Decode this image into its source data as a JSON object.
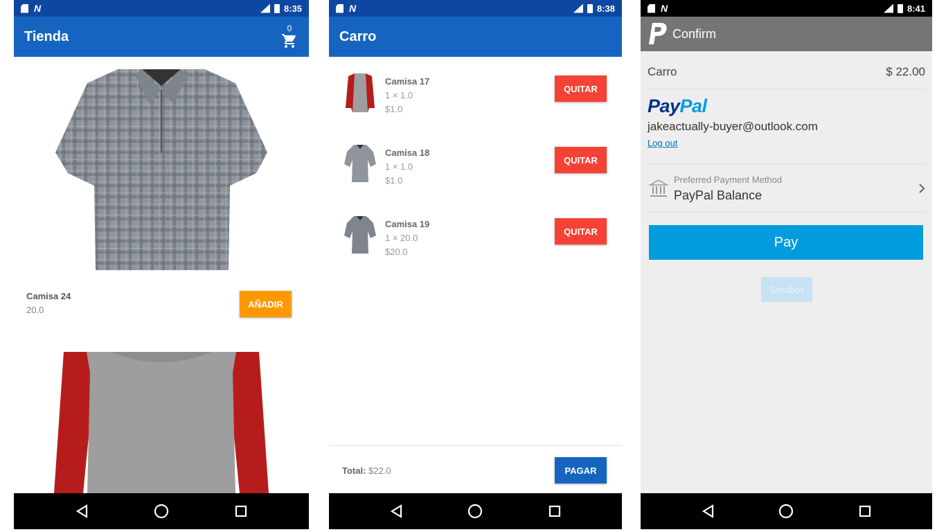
{
  "screen1": {
    "status": {
      "time": "8:35"
    },
    "appbar": {
      "title": "Tienda",
      "cart_count": "0"
    },
    "product": {
      "name": "Camisa 24",
      "price": "20.0",
      "add_label": "AÑADIR"
    }
  },
  "screen2": {
    "status": {
      "time": "8:38"
    },
    "appbar": {
      "title": "Carro"
    },
    "items": [
      {
        "name": "Camisa 17",
        "qty": "1 × 1.0",
        "price": "$1.0",
        "remove_label": "QUITAR"
      },
      {
        "name": "Camisa 18",
        "qty": "1 × 1.0",
        "price": "$1.0",
        "remove_label": "QUITAR"
      },
      {
        "name": "Camisa 19",
        "qty": "1 × 20.0",
        "price": "$20.0",
        "remove_label": "QUITAR"
      }
    ],
    "footer": {
      "total_label": "Total:",
      "total_value": "$22.0",
      "pay_label": "PAGAR"
    }
  },
  "screen3": {
    "status": {
      "time": "8:41"
    },
    "header": {
      "title": "Confirm"
    },
    "cart": {
      "label": "Carro",
      "amount": "$ 22.00"
    },
    "paypal": {
      "logo_pay": "Pay",
      "logo_pal": "Pal",
      "email": "jakeactually-buyer@outlook.com",
      "logout": "Log out"
    },
    "payment": {
      "caption": "Preferred Payment Method",
      "method": "PayPal Balance"
    },
    "pay_label": "Pay",
    "sandbox_label": "Sandbox"
  },
  "colors": {
    "primary": "#1565c0",
    "primary_dark": "#0d47a1",
    "orange": "#ff9800",
    "red": "#f44336",
    "paypal_blue": "#009cde",
    "paypal_navy": "#003087"
  }
}
